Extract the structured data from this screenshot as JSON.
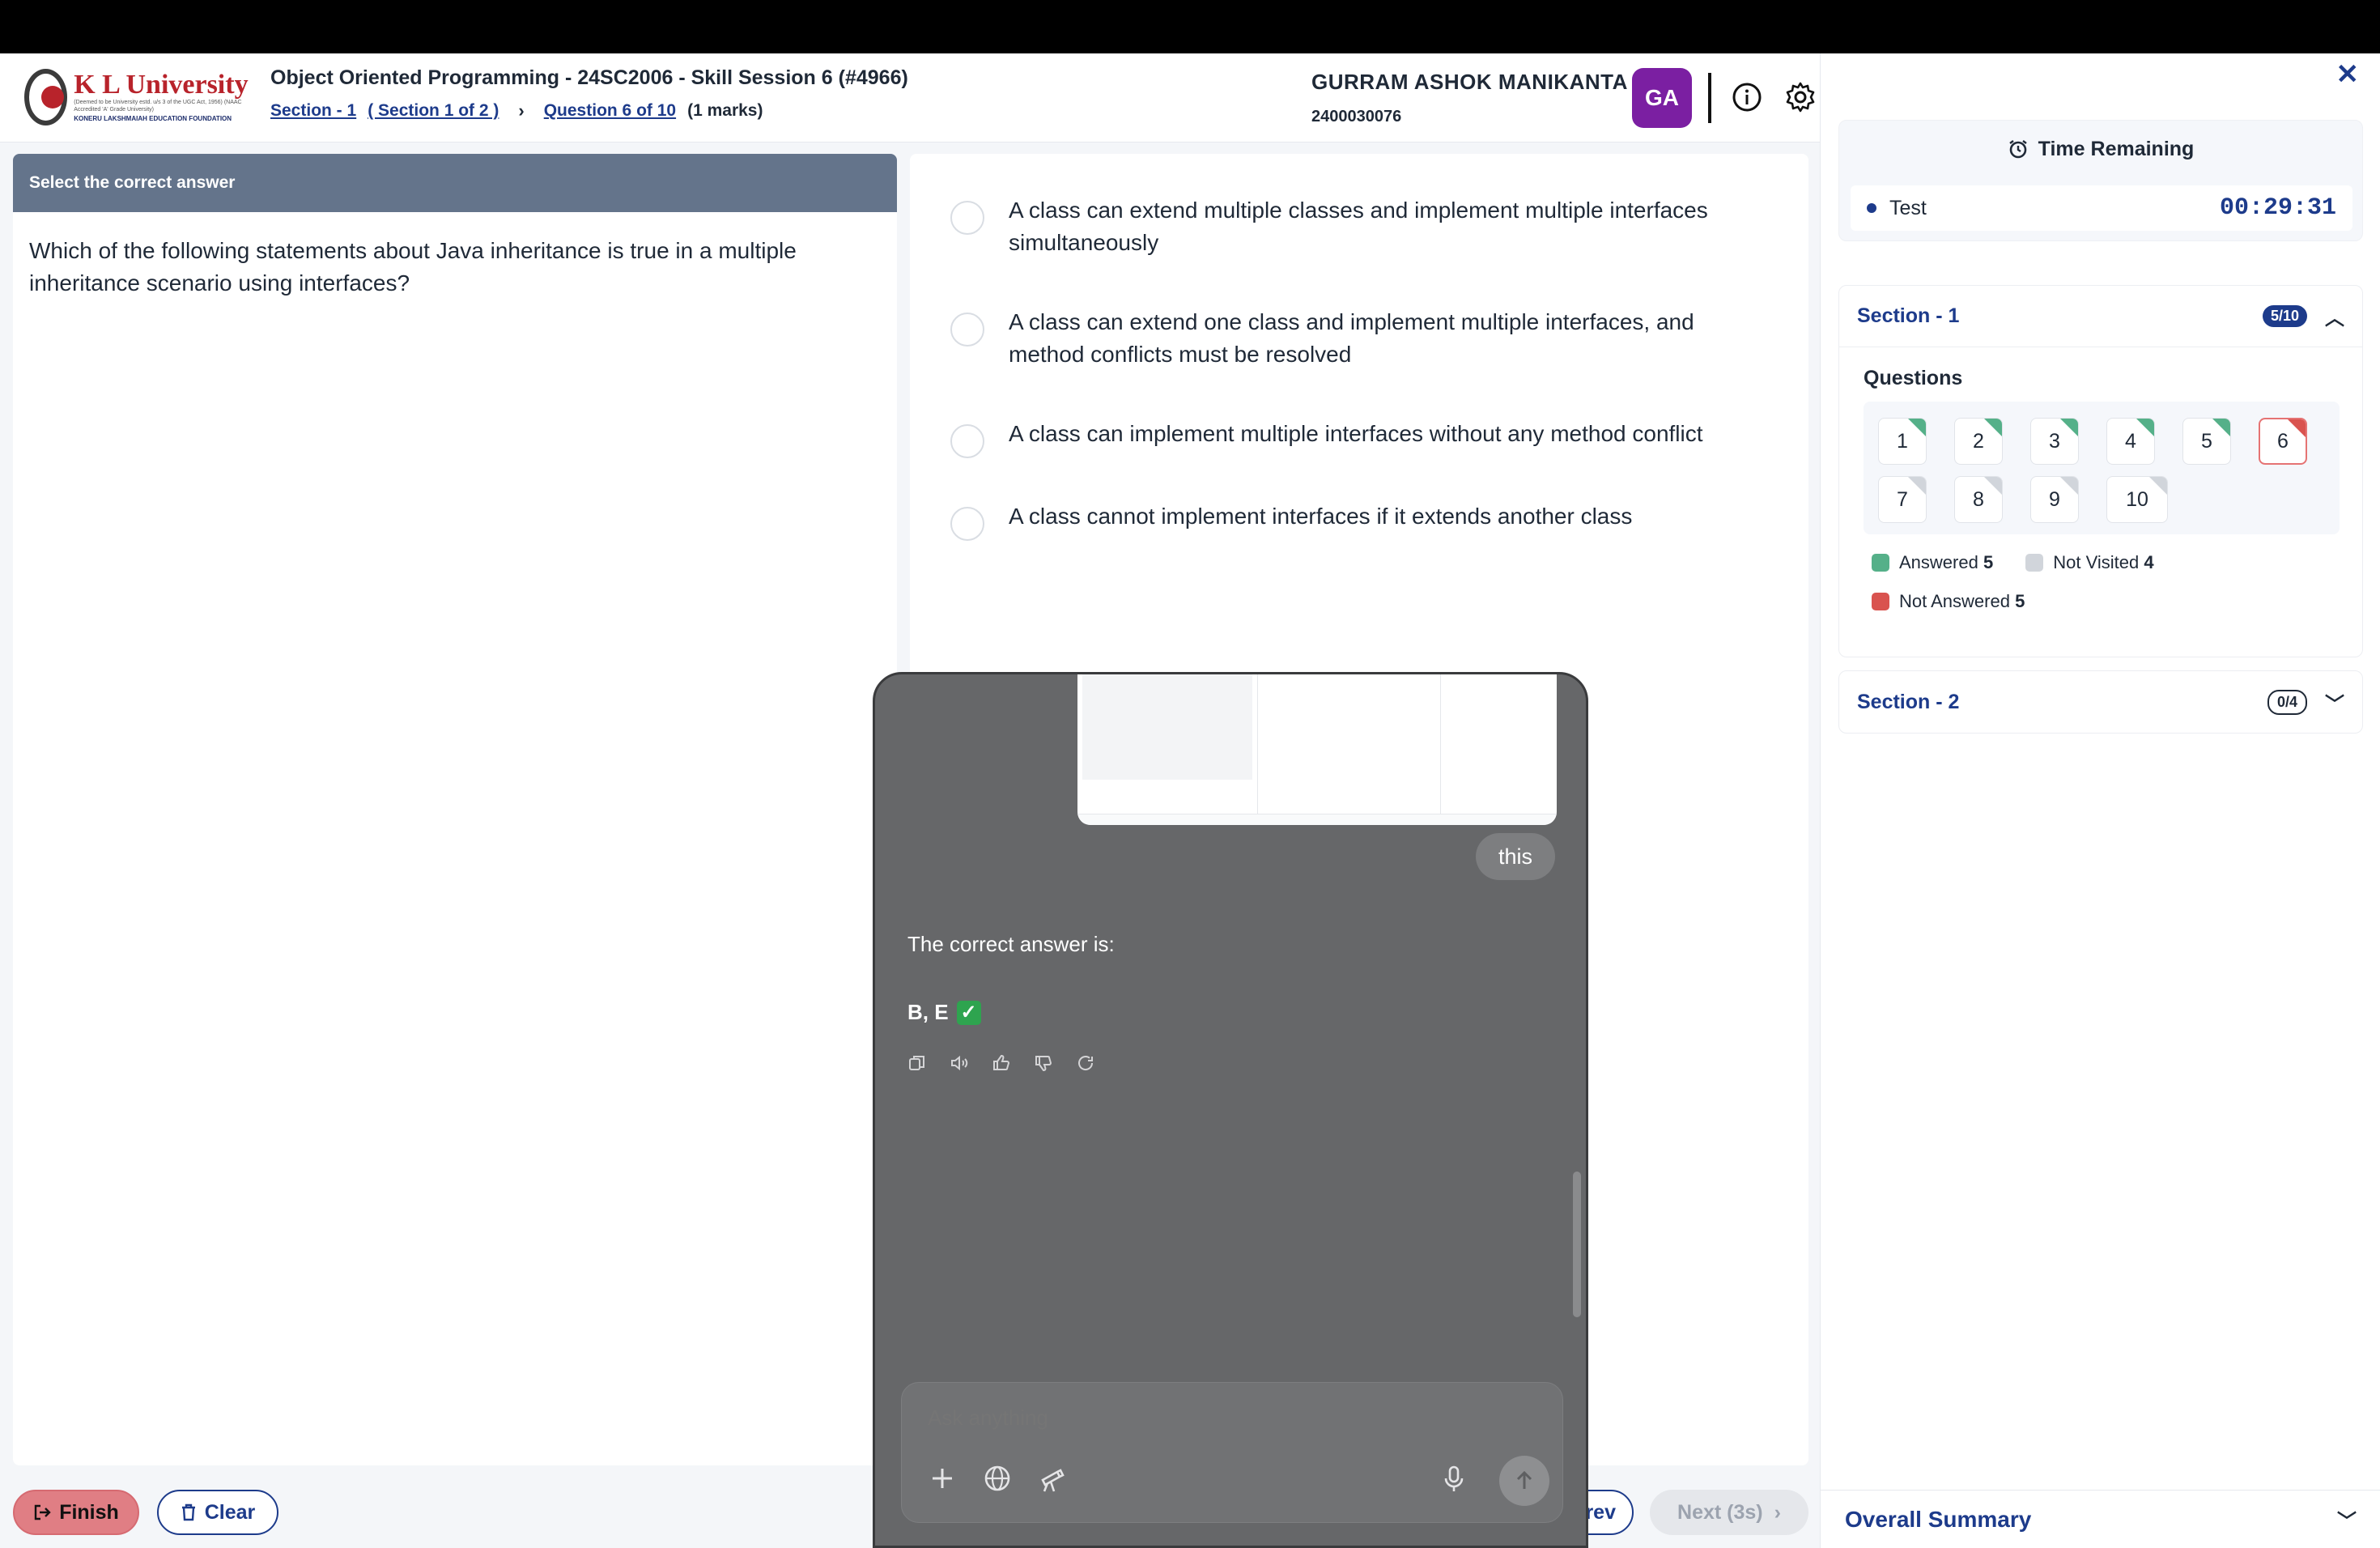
{
  "header": {
    "logo_text": "K L University",
    "logo_sub": "(Deemed to be University estd. u/s 3 of the UGC Act, 1956)  (NAAC Accredited 'A' Grade University)",
    "logo_foot": "KONERU LAKSHMAIAH EDUCATION FOUNDATION",
    "course_title": "Object Oriented Programming - 24SC2006 - Skill Session 6 (#4966)",
    "breadcrumb": {
      "section": "Section - 1",
      "section_of": "( Section 1 of 2 )",
      "question": "Question 6 of 10",
      "marks": "(1 marks)"
    },
    "student_name": "GURRAM ASHOK MANIKANTA",
    "student_id": "2400030076",
    "avatar_initials": "GA"
  },
  "question_panel": {
    "heading": "Select the correct answer",
    "text": "Which of the following statements about Java inheritance is true in a multiple inheritance scenario using interfaces?"
  },
  "options": [
    {
      "text": "A class can extend multiple classes and implement multiple interfaces simultaneously"
    },
    {
      "text": "A class can extend one class and implement multiple interfaces, and method conflicts must be resolved"
    },
    {
      "text": "A class can implement multiple interfaces without any method conflict"
    },
    {
      "text": "A class cannot implement interfaces if it extends another class"
    }
  ],
  "footer": {
    "finish_label": "Finish",
    "clear_label": "Clear",
    "prev_label": "rev",
    "next_label": "Next (3s)"
  },
  "sidebar": {
    "time_title": "Time Remaining",
    "test_label": "Test",
    "time_value": "00:29:31",
    "section1": {
      "title": "Section - 1",
      "badge": "5/10",
      "questions_label": "Questions",
      "questions": [
        {
          "n": "1",
          "status": "answered"
        },
        {
          "n": "2",
          "status": "answered"
        },
        {
          "n": "3",
          "status": "answered"
        },
        {
          "n": "4",
          "status": "answered"
        },
        {
          "n": "5",
          "status": "answered"
        },
        {
          "n": "6",
          "status": "not-answered",
          "current": true
        },
        {
          "n": "7",
          "status": "not-visited"
        },
        {
          "n": "8",
          "status": "not-visited"
        },
        {
          "n": "9",
          "status": "not-visited"
        },
        {
          "n": "10",
          "status": "not-visited"
        }
      ],
      "legend": {
        "answered_label": "Answered",
        "answered_count": "5",
        "not_visited_label": "Not Visited",
        "not_visited_count": "4",
        "not_answered_label": "Not Answered",
        "not_answered_count": "5"
      }
    },
    "section2": {
      "title": "Section - 2",
      "badge": "0/4"
    },
    "overall_summary": "Overall Summary"
  },
  "chat": {
    "user_message": "this",
    "answer_intro": "The correct answer is:",
    "answer_value": "B, E",
    "input_placeholder": "Ask anything"
  },
  "colors": {
    "brand_blue": "#1d3b8b",
    "answered": "#55b089",
    "not_answered": "#d9534f",
    "not_visited": "#d1d5db",
    "avatar": "#7b1fa2"
  }
}
